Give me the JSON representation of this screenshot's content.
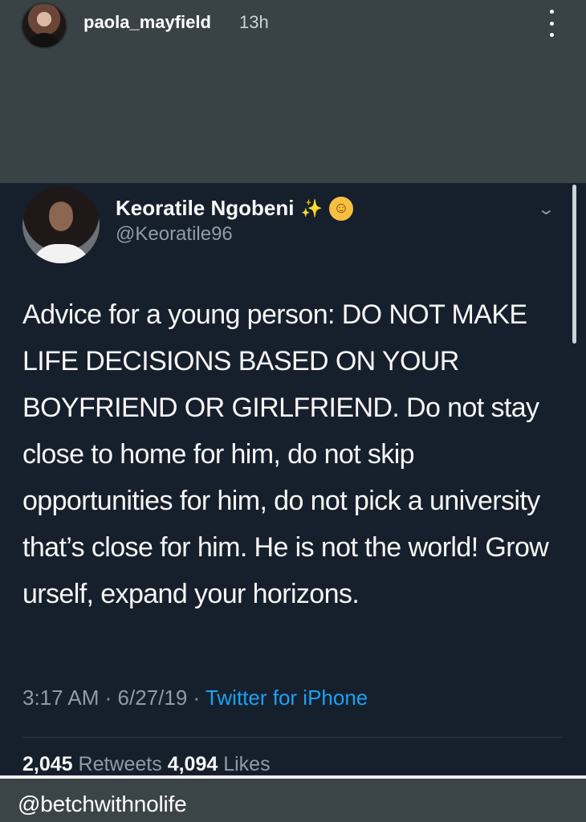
{
  "story": {
    "username": "paola_mayfield",
    "time": "13h"
  },
  "tweet": {
    "display_name": "Keoratile Ngobeni",
    "sparkle": "✨",
    "smile": "☺",
    "handle": "@Keoratile96",
    "text": "Advice for a young person: DO NOT MAKE LIFE DECISIONS BASED ON YOUR BOYFRIEND OR GIRLFRIEND. Do not stay close to home for him, do not skip opportunities for him, do not pick a university that’s close for him. He is not the world! Grow urself, expand your horizons.",
    "time": "3:17 AM",
    "date": "6/27/19",
    "source": "Twitter for iPhone",
    "retweets_count": "2,045",
    "retweets_label": "Retweets",
    "likes_count": "4,094",
    "likes_label": "Likes"
  },
  "watermark": "@betchwithnolife",
  "colors": {
    "story_background": "#394245",
    "tweet_background": "#16202c",
    "link_blue": "#1da1f2",
    "muted_text": "#8f9ba6"
  }
}
